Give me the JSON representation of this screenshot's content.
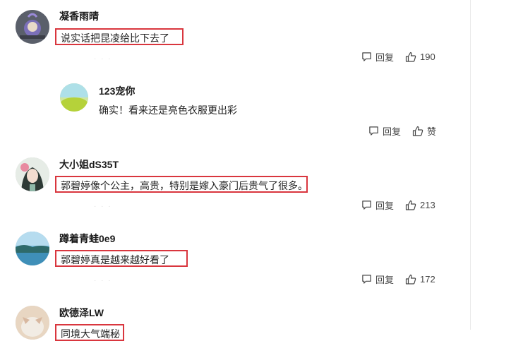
{
  "comments": [
    {
      "username": "凝香雨晴",
      "text": "说实话把昆凌给比下去了",
      "reply_label": "回复",
      "likes": "190",
      "reply": {
        "username": "123宠你",
        "text": "确实！看来还是亮色衣服更出彩",
        "reply_label": "回复",
        "like_label": "赞"
      }
    },
    {
      "username": "大小姐dS35T",
      "text": "郭碧婷像个公主，高贵，特别是嫁入豪门后贵气了很多。",
      "reply_label": "回复",
      "likes": "213"
    },
    {
      "username": "蹲着青蛙0e9",
      "text": "郭碧婷真是越来越好看了",
      "reply_label": "回复",
      "likes": "172"
    },
    {
      "username": "欧德泽LW",
      "text": "同境大气端秘"
    }
  ],
  "colors": {
    "highlight_border": "#d9363e",
    "divider": "#e9e9e9"
  },
  "icons": [
    "comment-icon",
    "thumbs-up-icon"
  ]
}
